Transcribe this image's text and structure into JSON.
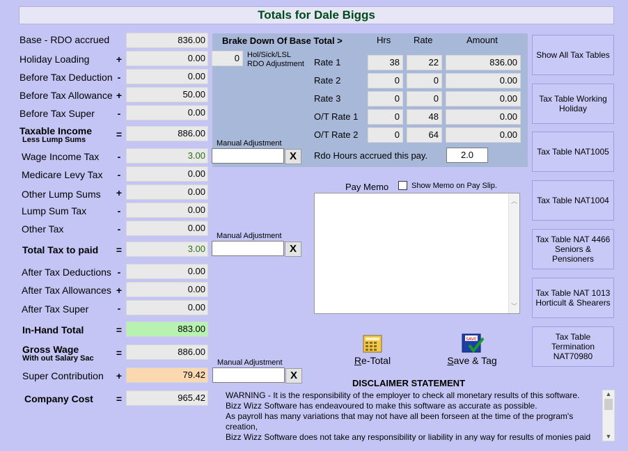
{
  "window": {
    "title": "Totals for Dale Biggs"
  },
  "left": {
    "rows": [
      {
        "label": "Base - RDO accrued",
        "op": "",
        "value": "836.00"
      },
      {
        "label": "Holiday Loading",
        "op": "+",
        "value": "0.00"
      },
      {
        "label": "Before Tax Deduction",
        "op": "-",
        "value": "0.00"
      },
      {
        "label": "Before Tax Allowance",
        "op": "+",
        "value": "50.00"
      },
      {
        "label": "Before Tax Super",
        "op": "-",
        "value": "0.00"
      },
      {
        "label": "Taxable Income",
        "sub": "Less Lump Sums",
        "op": "=",
        "value": "886.00"
      },
      {
        "label": "Wage Income Tax",
        "op": "-",
        "value": "3.00"
      },
      {
        "label": "Medicare Levy Tax",
        "op": "-",
        "value": "0.00"
      },
      {
        "label": "Other Lump Sums",
        "op": "+",
        "value": "0.00"
      },
      {
        "label": "Lump Sum Tax",
        "op": "-",
        "value": "0.00"
      },
      {
        "label": "Other Tax",
        "op": "-",
        "value": "0.00"
      },
      {
        "label": "Total Tax to paid",
        "op": "=",
        "value": "3.00"
      },
      {
        "label": "After Tax Deductions",
        "op": "-",
        "value": "0.00"
      },
      {
        "label": "After Tax Allowances",
        "op": "+",
        "value": "0.00"
      },
      {
        "label": "After Tax Super",
        "op": "-",
        "value": "0.00"
      },
      {
        "label": "In-Hand Total",
        "op": "=",
        "value": "883.00"
      },
      {
        "label": "Gross Wage",
        "sub": "With out Salary Sac",
        "op": "=",
        "value": "886.00"
      },
      {
        "label": "Super Contribution",
        "op": "+",
        "value": "79.42"
      },
      {
        "label": "Company Cost",
        "op": "=",
        "value": "965.42"
      }
    ]
  },
  "hol_sick": {
    "value": "0",
    "label1": "Hol/Sick/LSL",
    "label2": "RDO Adjustment"
  },
  "adjustments": {
    "label": "Manual Adjustment",
    "clear": "X"
  },
  "breakdown": {
    "title": "Brake Down Of Base Total >",
    "headers": {
      "hrs": "Hrs",
      "rate": "Rate",
      "amount": "Amount"
    },
    "rows": [
      {
        "label": "Rate 1",
        "hrs": "38",
        "rate": "22",
        "amount": "836.00"
      },
      {
        "label": "Rate 2",
        "hrs": "0",
        "rate": "0",
        "amount": "0.00"
      },
      {
        "label": "Rate 3",
        "hrs": "0",
        "rate": "0",
        "amount": "0.00"
      },
      {
        "label": "O/T Rate 1",
        "hrs": "0",
        "rate": "48",
        "amount": "0.00"
      },
      {
        "label": "O/T Rate 2",
        "hrs": "0",
        "rate": "64",
        "amount": "0.00"
      }
    ],
    "rdo_label": "Rdo Hours accrued this pay.",
    "rdo_value": "2.0"
  },
  "memo": {
    "label": "Pay Memo",
    "checkbox_label": "Show Memo on Pay Slip.",
    "text": ""
  },
  "actions": {
    "retotal_first": "R",
    "retotal_rest": "e-Total",
    "save_first": "S",
    "save_rest": "ave & Tag",
    "save_icon_text": "SAVE"
  },
  "side_buttons": [
    "Show All Tax Tables",
    "Tax Table Working Holiday",
    "Tax Table NAT1005",
    "Tax Table NAT1004",
    "Tax Table NAT 4466 Seniors & Pensioners",
    "Tax Table NAT 1013 Horticult & Shearers",
    "Tax Table Termination NAT70980"
  ],
  "disclaimer": {
    "title": "DISCLAIMER  STATEMENT",
    "lines": [
      "WARNING - It is the responsibility of the employer to check all monetary results of this software.",
      "Bizz Wizz Software has endeavoured  to make this software as accurate as possible.",
      "As payroll has many variations that may not have all been forseen at the time of the  program's creation,",
      "Bizz Wizz Software does not take any responsibility or liability in any way for results of monies paid"
    ]
  },
  "colors": {
    "background": "#c5c5f5",
    "title_text": "#004a1a",
    "panel": "#a8b8d8",
    "in_hand": "#b8f2b0",
    "super": "#fbd9b0"
  }
}
